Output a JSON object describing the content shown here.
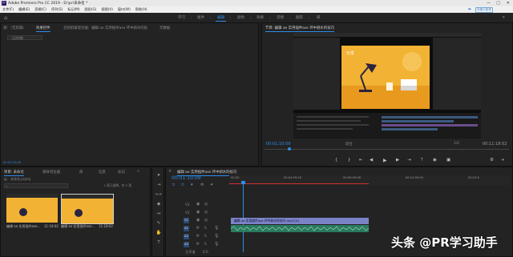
{
  "titlebar": {
    "logo": "Pr",
    "title": "Adobe Premiere Pro CC 2019 - D:\\pr\\未命名 *",
    "min": "—",
    "max": "□",
    "close": "✕"
  },
  "menubar": {
    "items": [
      "文件(F)",
      "编辑(E)",
      "剪辑(C)",
      "序列(S)",
      "标记(M)",
      "图形(G)",
      "视图(V)",
      "窗口(W)",
      "帮助(H)"
    ],
    "cloud_label": "与他人协作"
  },
  "workspaces": {
    "tabs": [
      "学习",
      "组件",
      "编辑",
      "颜色",
      "效果",
      "音频",
      "图形",
      "库"
    ],
    "active": "编辑",
    "more": "»"
  },
  "source_panel": {
    "tabs": [
      "源：（无剪辑）",
      "效果控件",
      "音频剪辑混合器：编辑 ae 实用插件ase 环中剥水的技巧",
      "元数据"
    ],
    "active_tab": "效果控件",
    "dropdown": "（无剪辑）",
    "timecode": "00:01:10:09"
  },
  "program_panel": {
    "title": "节目: 编辑 ae 实用插件ase 环中剥水的技巧",
    "current_time": "00:01:10:09",
    "fit": "适合",
    "ratio": "1/2",
    "duration": "00:11:18:02",
    "artboard_text": "分享"
  },
  "project_panel": {
    "tabs": [
      "项目: 未命名",
      "媒体浏览器",
      "库",
      "信息",
      "标记"
    ],
    "active_tab": "项目: 未命名",
    "search_placeholder": "",
    "file_name": "未命名.prproj",
    "count": "1 项已选择，共 2 项",
    "items": [
      {
        "name": "编辑 ae 实用插件ase...",
        "duration": "11:18:02"
      },
      {
        "name": "编辑 ae 实用插件ase...",
        "duration": "11:18:02"
      }
    ]
  },
  "timeline_panel": {
    "tab": "编辑 ae 实用插件ase 环中剥水的技巧",
    "timecode": "00:01:10:09",
    "ruler": [
      "00:00",
      "00:04:59:16",
      "00:09:59:08",
      "00:14:59:00",
      "00:19:5"
    ],
    "video_tracks": [
      "V3",
      "V2",
      "V1"
    ],
    "audio_tracks": [
      "A1",
      "A2",
      "A3"
    ],
    "master": "主声道",
    "master_value": "0.0",
    "video_clip": "编辑 ae 实用插件ase 环中剥水的技巧.mp4 [V]"
  },
  "watermark": "头条 @PR学习助手"
}
